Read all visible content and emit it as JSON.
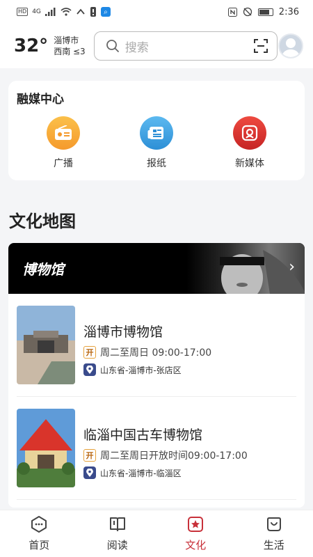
{
  "status_bar": {
    "time": "2:36",
    "hd_badge": "HD",
    "network": "4G"
  },
  "header": {
    "temperature": "32°",
    "city": "淄博市",
    "wind": "西南 ≤3",
    "search_placeholder": "搜索"
  },
  "media_center": {
    "title": "融媒中心",
    "items": [
      {
        "label": "广播",
        "icon": "radio-icon",
        "color": "#f7a93b"
      },
      {
        "label": "报纸",
        "icon": "newspaper-icon",
        "color": "#3a9fe0"
      },
      {
        "label": "新媒体",
        "icon": "new-media-icon",
        "color": "#d9302f"
      }
    ]
  },
  "culture_map": {
    "title": "文化地图",
    "banner_title": "博物馆"
  },
  "museums": [
    {
      "name": "淄博市博物馆",
      "open_badge": "开",
      "hours": "周二至周日 09:00-17:00",
      "address": "山东省-淄博市-张店区"
    },
    {
      "name": "临淄中国古车博物馆",
      "open_badge": "开",
      "hours": "周二至周日开放时间09:00-17:00",
      "address": "山东省-淄博市-临淄区"
    }
  ],
  "tabbar": {
    "items": [
      {
        "label": "首页",
        "icon": "home-icon"
      },
      {
        "label": "阅读",
        "icon": "book-icon"
      },
      {
        "label": "文化",
        "icon": "culture-icon",
        "active": true
      },
      {
        "label": "生活",
        "icon": "life-icon"
      }
    ],
    "active_color": "#c8313a"
  }
}
